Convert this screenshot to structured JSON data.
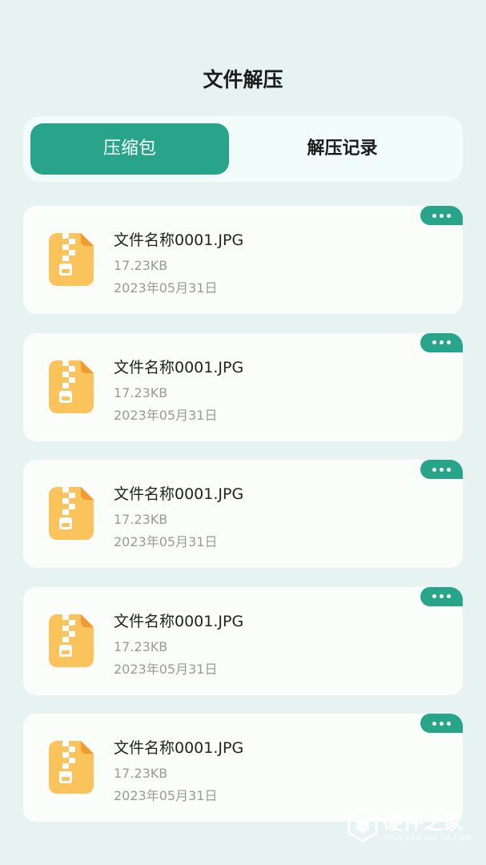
{
  "header": {
    "title": "文件解压"
  },
  "tabs": [
    {
      "label": "压缩包",
      "active": true
    },
    {
      "label": "解压记录",
      "active": false
    }
  ],
  "files": [
    {
      "name": "文件名称0001.JPG",
      "size": "17.23KB",
      "date": "2023年05月31日",
      "icon": "zip-file-icon"
    },
    {
      "name": "文件名称0001.JPG",
      "size": "17.23KB",
      "date": "2023年05月31日",
      "icon": "zip-file-icon"
    },
    {
      "name": "文件名称0001.JPG",
      "size": "17.23KB",
      "date": "2023年05月31日",
      "icon": "zip-file-icon"
    },
    {
      "name": "文件名称0001.JPG",
      "size": "17.23KB",
      "date": "2023年05月31日",
      "icon": "zip-file-icon"
    },
    {
      "name": "文件名称0001.JPG",
      "size": "17.23KB",
      "date": "2023年05月31日",
      "icon": "zip-file-icon"
    }
  ],
  "watermark": {
    "brand": "硬件之家",
    "subtitle": "YING JIAN ZHI JIA.COM"
  },
  "colors": {
    "accent": "#27a48a",
    "background": "#e7f3f1",
    "card": "#fbfdfb",
    "zip_icon": "#fbc35b"
  }
}
